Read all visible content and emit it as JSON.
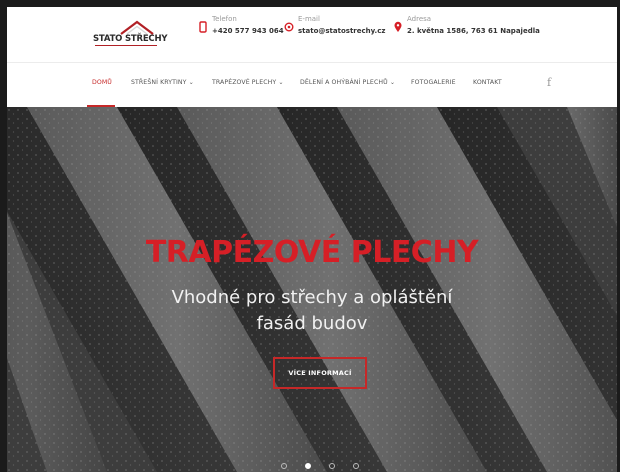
{
  "brand": {
    "name": "STATO STŘECHY"
  },
  "contacts": [
    {
      "icon": "phone-icon",
      "label": "Telefon",
      "value": "+420 577 943 064"
    },
    {
      "icon": "email-icon",
      "label": "E-mail",
      "value": "stato@statostrechy.cz"
    },
    {
      "icon": "location-pin-icon",
      "label": "Adresa",
      "value": "2. května 1586, 763 61 Napajedla"
    }
  ],
  "nav": {
    "items": [
      {
        "label": "DOMŮ",
        "active": true
      },
      {
        "label": "STŘEŠNÍ KRYTINY",
        "dropdown": true
      },
      {
        "label": "TRAPÉZOVÉ PLECHY",
        "dropdown": true
      },
      {
        "label": "DĚLENÍ A OHÝBÁNÍ PLECHŮ",
        "dropdown": true
      },
      {
        "label": "FOTOGALERIE"
      },
      {
        "label": "KONTAKT"
      }
    ],
    "social": "f"
  },
  "hero": {
    "title": "TRAPÉZOVÉ PLECHY",
    "subtitle_line1": "Vhodné pro střechy a opláštění",
    "subtitle_line2": "fasád budov",
    "cta": "VÍCE INFORMACÍ",
    "slides": 4,
    "active_slide": 2
  },
  "colors": {
    "accent": "#c62828"
  }
}
